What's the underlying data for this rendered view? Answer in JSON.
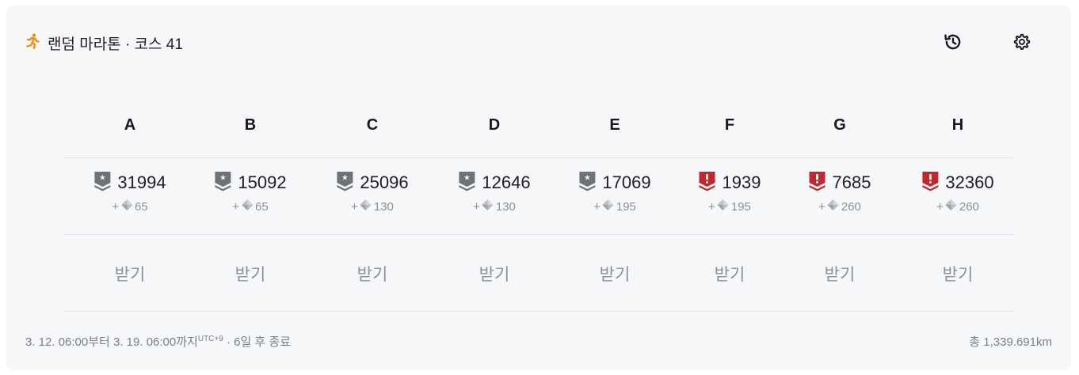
{
  "header": {
    "title": "랜덤 마라톤 · 코스 41",
    "icon": "running-person-icon",
    "accent": "#f08c1e",
    "history_icon": "history-icon",
    "settings_icon": "gear-icon"
  },
  "columns": [
    {
      "label": "A",
      "value": "31994",
      "badge": "silver-shield",
      "reward": "65"
    },
    {
      "label": "B",
      "value": "15092",
      "badge": "silver-shield",
      "reward": "65"
    },
    {
      "label": "C",
      "value": "25096",
      "badge": "silver-shield",
      "reward": "130"
    },
    {
      "label": "D",
      "value": "12646",
      "badge": "silver-shield",
      "reward": "130"
    },
    {
      "label": "E",
      "value": "17069",
      "badge": "silver-shield",
      "reward": "195"
    },
    {
      "label": "F",
      "value": "1939",
      "badge": "red-alert-shield",
      "reward": "195"
    },
    {
      "label": "G",
      "value": "7685",
      "badge": "red-alert-shield",
      "reward": "260"
    },
    {
      "label": "H",
      "value": "32360",
      "badge": "red-alert-shield",
      "reward": "260"
    }
  ],
  "reward_prefix": "+",
  "claim_label": "받기",
  "colors": {
    "silver": "#6f7378",
    "red": "#c0282f",
    "muted": "#8b9099"
  },
  "footer": {
    "period": "3. 12. 06:00부터 3. 19. 06:00까지",
    "tz": "UTC+9",
    "remaining": " · 6일 후 종료",
    "total": "총 1,339.691km"
  }
}
